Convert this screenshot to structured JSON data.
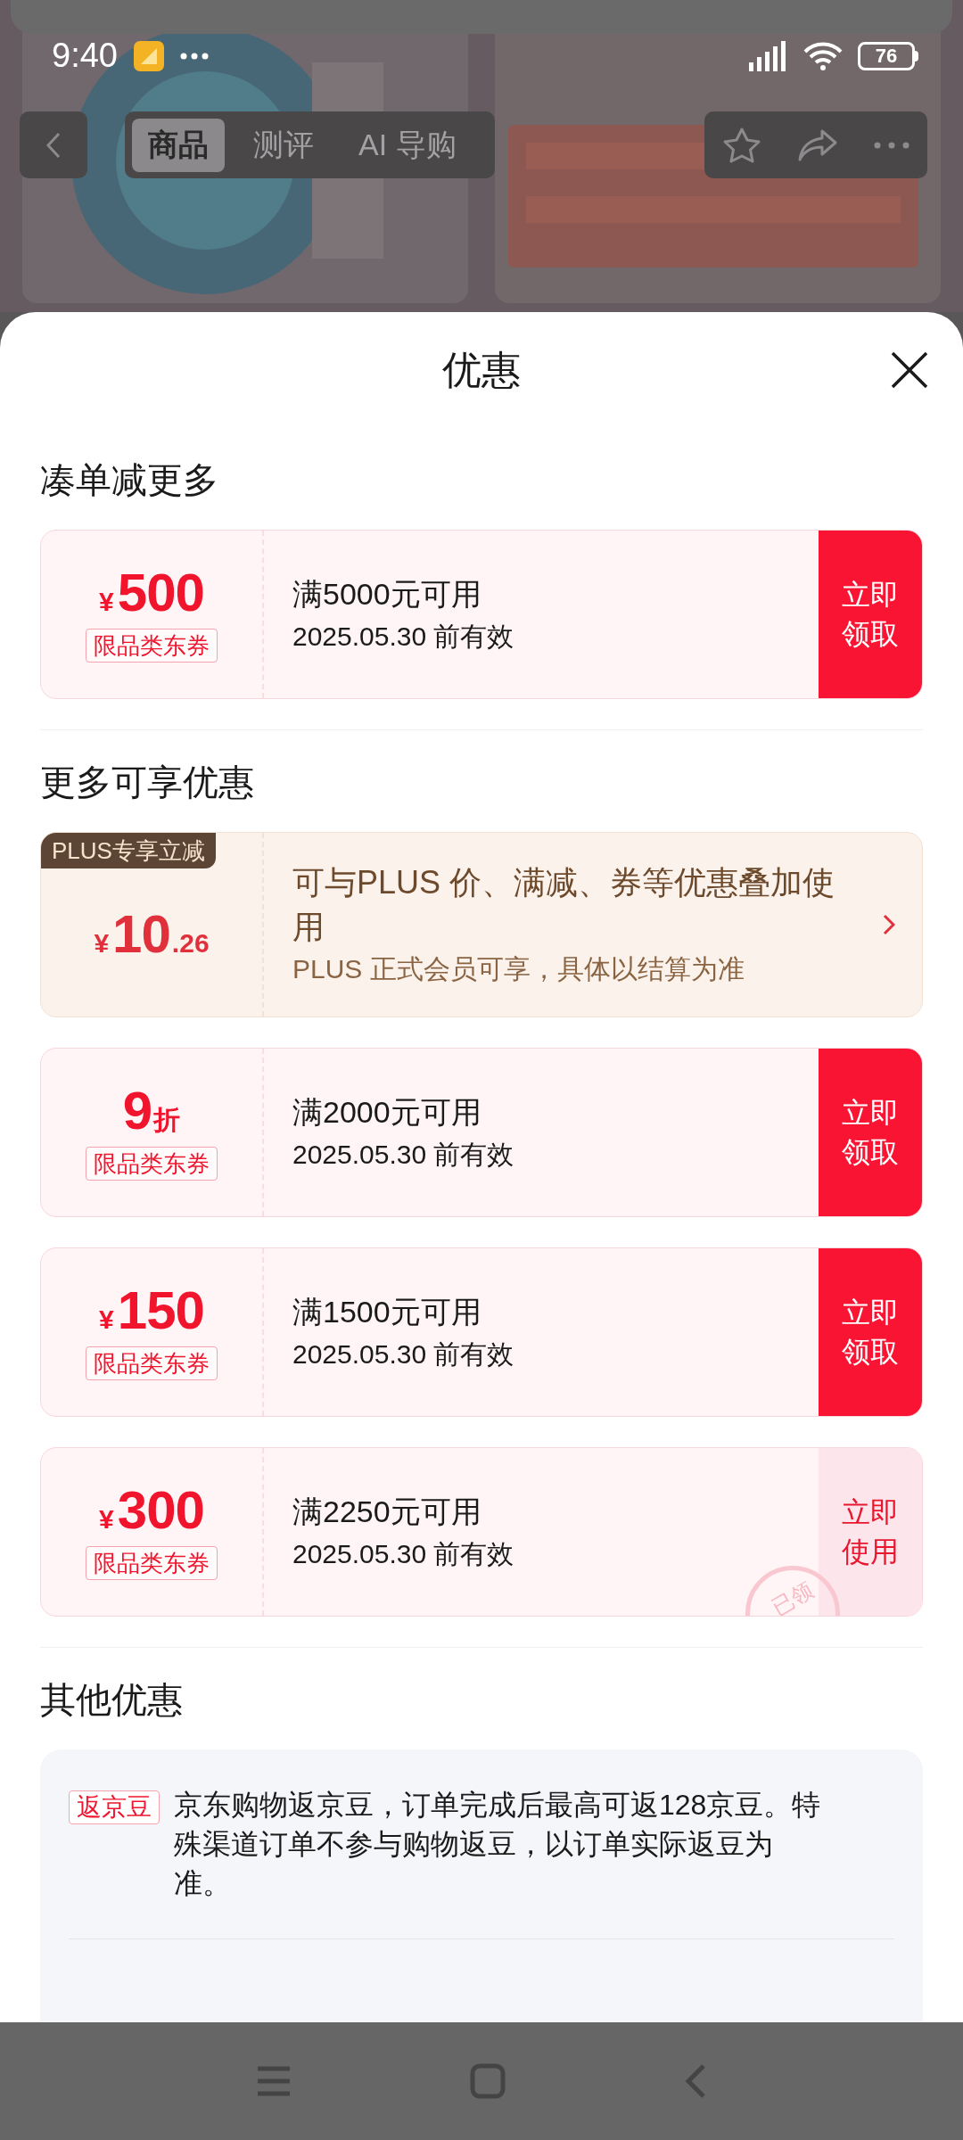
{
  "status_bar": {
    "time": "9:40",
    "battery": "76"
  },
  "product_nav": {
    "tabs": [
      {
        "label": "商品",
        "selected": true
      },
      {
        "label": "测评",
        "selected": false
      },
      {
        "label": "AI 导购",
        "selected": false
      }
    ]
  },
  "sheet": {
    "title": "优惠",
    "sections": [
      {
        "title": "凑单减更多",
        "items": [
          {
            "kind": "coupon",
            "prefix": "¥",
            "amount": "500",
            "tag": "限品类东券",
            "condition": "满5000元可用",
            "validity": "2025.05.30 前有效",
            "action": "立即领取",
            "claimed": false
          }
        ]
      },
      {
        "title": "更多可享优惠",
        "items": [
          {
            "kind": "plus",
            "badge": "PLUS专享立减",
            "prefix": "¥",
            "amount": "10",
            "suffix": ".26",
            "headline": "可与PLUS 价、满减、券等优惠叠加使用",
            "note": "PLUS 正式会员可享，具体以结算为准"
          },
          {
            "kind": "coupon",
            "amount": "9",
            "suffix": "折",
            "tag": "限品类东券",
            "condition": "满2000元可用",
            "validity": "2025.05.30 前有效",
            "action": "立即领取",
            "claimed": false
          },
          {
            "kind": "coupon",
            "prefix": "¥",
            "amount": "150",
            "tag": "限品类东券",
            "condition": "满1500元可用",
            "validity": "2025.05.30 前有效",
            "action": "立即领取",
            "claimed": false
          },
          {
            "kind": "coupon",
            "prefix": "¥",
            "amount": "300",
            "tag": "限品类东券",
            "condition": "满2250元可用",
            "validity": "2025.05.30 前有效",
            "action": "立即使用",
            "claimed": true,
            "stamp": "已领"
          }
        ]
      },
      {
        "title": "其他优惠",
        "items": [
          {
            "kind": "info",
            "tag": "返京豆",
            "text": "京东购物返京豆，订单完成后最高可返128京豆。特殊渠道订单不参与购物返豆，以订单实际返豆为准。"
          }
        ]
      }
    ]
  }
}
